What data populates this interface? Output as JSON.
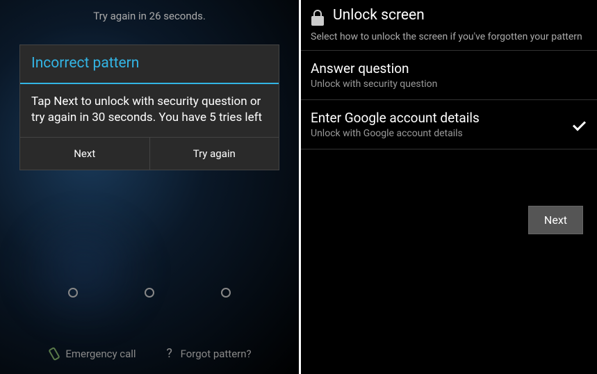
{
  "left": {
    "top_message": "Try again in 26 seconds.",
    "dialog": {
      "title": "Incorrect pattern",
      "body": "Tap Next to unlock with security question or try again in 30 seconds. You have 5 tries left",
      "next_label": "Next",
      "try_again_label": "Try again"
    },
    "bottom": {
      "emergency_label": "Emergency call",
      "forgot_label": "Forgot pattern?",
      "question_mark": "?"
    }
  },
  "right": {
    "title": "Unlock screen",
    "subtitle": "Select how to unlock the screen if you've forgotten your pattern",
    "options": [
      {
        "title": "Answer question",
        "sub": "Unlock with security question",
        "selected": false
      },
      {
        "title": "Enter Google account details",
        "sub": "Unlock with Google account details",
        "selected": true
      }
    ],
    "next_label": "Next"
  }
}
